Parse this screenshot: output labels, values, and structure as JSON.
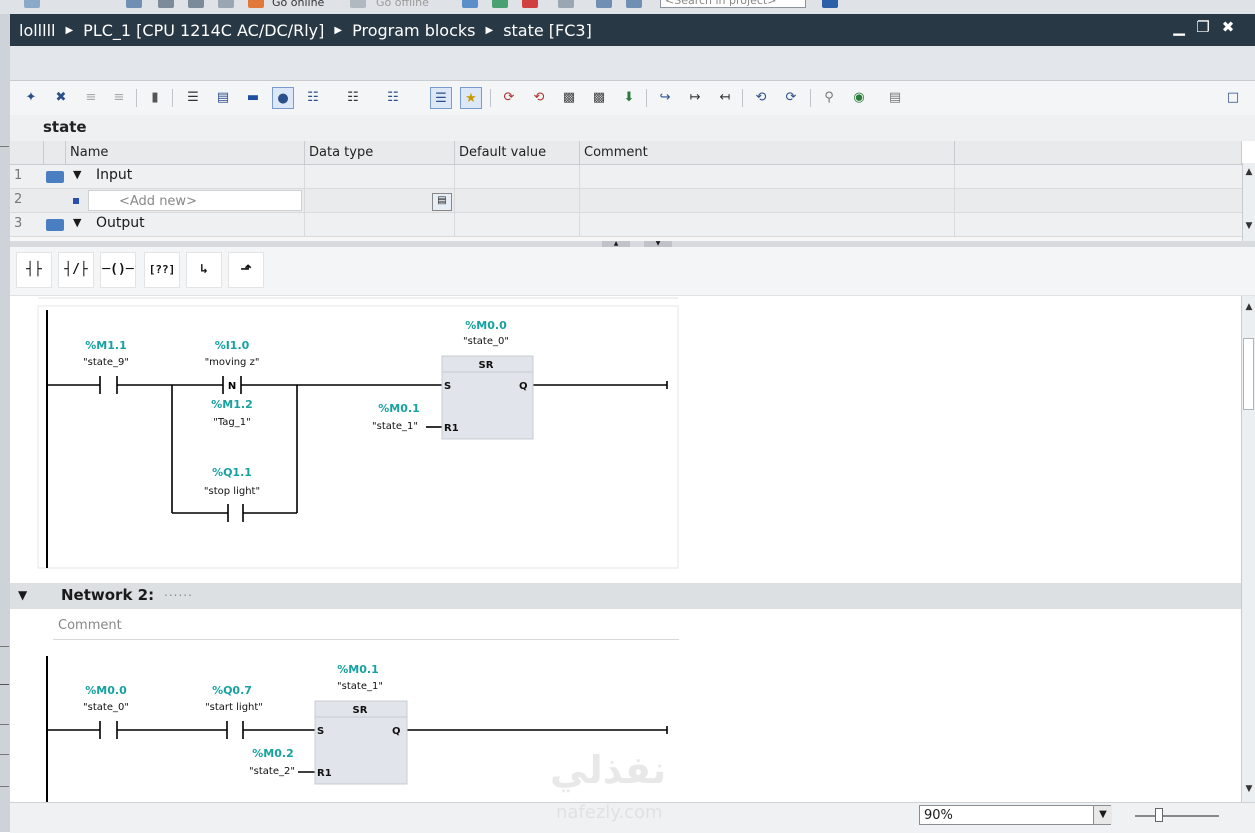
{
  "top_strip": {
    "go_online": "Go online",
    "go_offline": "Go offline",
    "search_placeholder": "<Search in project>"
  },
  "breadcrumb": {
    "items": [
      "lolllll",
      "PLC_1 [CPU 1214C AC/DC/Rly]",
      "Program blocks",
      "state [FC3]"
    ]
  },
  "window_controls": {
    "minimize": "▁",
    "restore": "❐",
    "close": "✖"
  },
  "interface": {
    "title": "state",
    "columns": [
      "Name",
      "Data type",
      "Default value",
      "Comment"
    ],
    "rows": [
      {
        "num": "1",
        "name": "Input",
        "kind": "section"
      },
      {
        "num": "2",
        "name": "<Add new>",
        "kind": "add"
      },
      {
        "num": "3",
        "name": "Output",
        "kind": "section"
      }
    ]
  },
  "lad_palette": {
    "items": [
      {
        "icon": "normally-open-contact-icon",
        "glyph": "┤├"
      },
      {
        "icon": "normally-closed-contact-icon",
        "glyph": "┤/├"
      },
      {
        "icon": "output-coil-icon",
        "glyph": "─()─"
      },
      {
        "icon": "empty-box-icon",
        "glyph": "[??]"
      },
      {
        "icon": "open-branch-icon",
        "glyph": "↳"
      },
      {
        "icon": "close-branch-icon",
        "glyph": "⬏"
      }
    ]
  },
  "networks": [
    {
      "title": "",
      "contacts": [
        {
          "addr": "%M1.1",
          "tag": "\"state_9\""
        },
        {
          "addr": "%I1.0",
          "tag": "\"moving z\"",
          "type": "N"
        },
        {
          "addr": "%M1.2",
          "tag": "\"Tag_1\""
        },
        {
          "addr": "%Q1.1",
          "tag": "\"stop light\""
        }
      ],
      "block": {
        "type": "SR",
        "addr": "%M0.0",
        "tag": "\"state_0\"",
        "pin_s": "S",
        "pin_q": "Q",
        "pin_r": "R1",
        "r_addr": "%M0.1",
        "r_tag": "\"state_1\""
      }
    },
    {
      "title": "Network 2:",
      "dots": "......",
      "comment_placeholder": "Comment",
      "contacts": [
        {
          "addr": "%M0.0",
          "tag": "\"state_0\""
        },
        {
          "addr": "%Q0.7",
          "tag": "\"start light\""
        }
      ],
      "block": {
        "type": "SR",
        "addr": "%M0.1",
        "tag": "\"state_1\"",
        "pin_s": "S",
        "pin_q": "Q",
        "pin_r": "R1",
        "r_addr": "%M0.2",
        "r_tag": "\"state_2\""
      }
    }
  ],
  "status_bar": {
    "zoom": "90%"
  },
  "watermark": {
    "text": "نفذلي",
    "sub": "nafezly.com"
  },
  "colors": {
    "title_bar": "#283845",
    "operand": "#17a2a0",
    "block_fill": "#e1e4ea"
  }
}
